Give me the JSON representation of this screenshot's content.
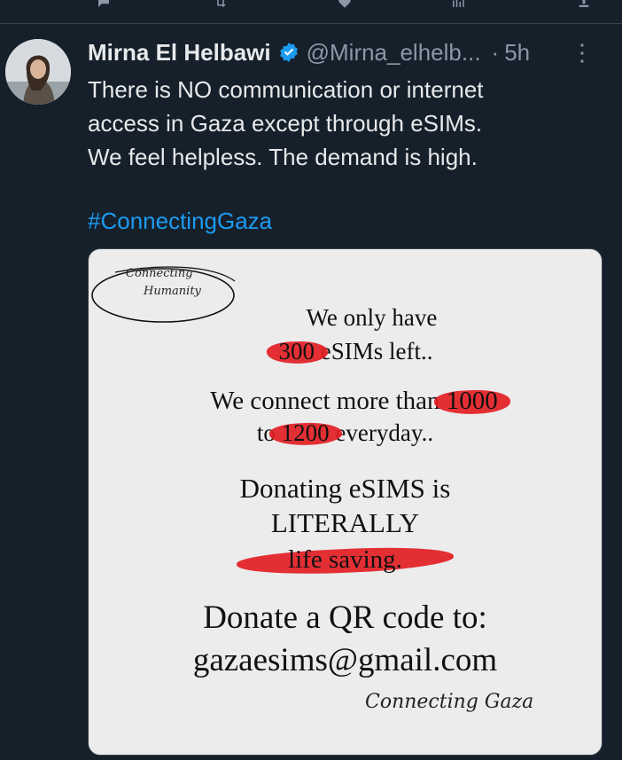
{
  "tweet": {
    "author_name": "Mirna El Helbawi",
    "handle": "@Mirna_elhelb...",
    "separator": "·",
    "time": "5h",
    "more": "⋮",
    "text_lines": [
      "There is NO communication or internet",
      "access in Gaza except through eSIMs.",
      "We feel helpless. The demand is high."
    ],
    "hashtag": "#ConnectingGaza"
  },
  "image": {
    "logo_line1": "Connecting",
    "logo_line2": "Humanity",
    "l1": "We only have",
    "l2_num": "300",
    "l2_rest": " eSIMs left..",
    "l3_pre": "We connect more than ",
    "l3_num": "1000",
    "l4_pre": "to ",
    "l4_num": "1200",
    "l4_rest": " everyday..",
    "l5": "Donating eSIMS is",
    "l6": "LITERALLY",
    "l7": "life saving.",
    "l8": "Donate a QR code to:",
    "l9": "gazaesims@gmail.com",
    "signature": "Connecting Gaza"
  },
  "colors": {
    "background": "#15202b",
    "accent": "#1d9bf0",
    "highlight": "#e21e24"
  },
  "icons": [
    "reply-icon",
    "retweet-icon",
    "like-icon",
    "views-icon",
    "share-icon",
    "verified-icon"
  ]
}
